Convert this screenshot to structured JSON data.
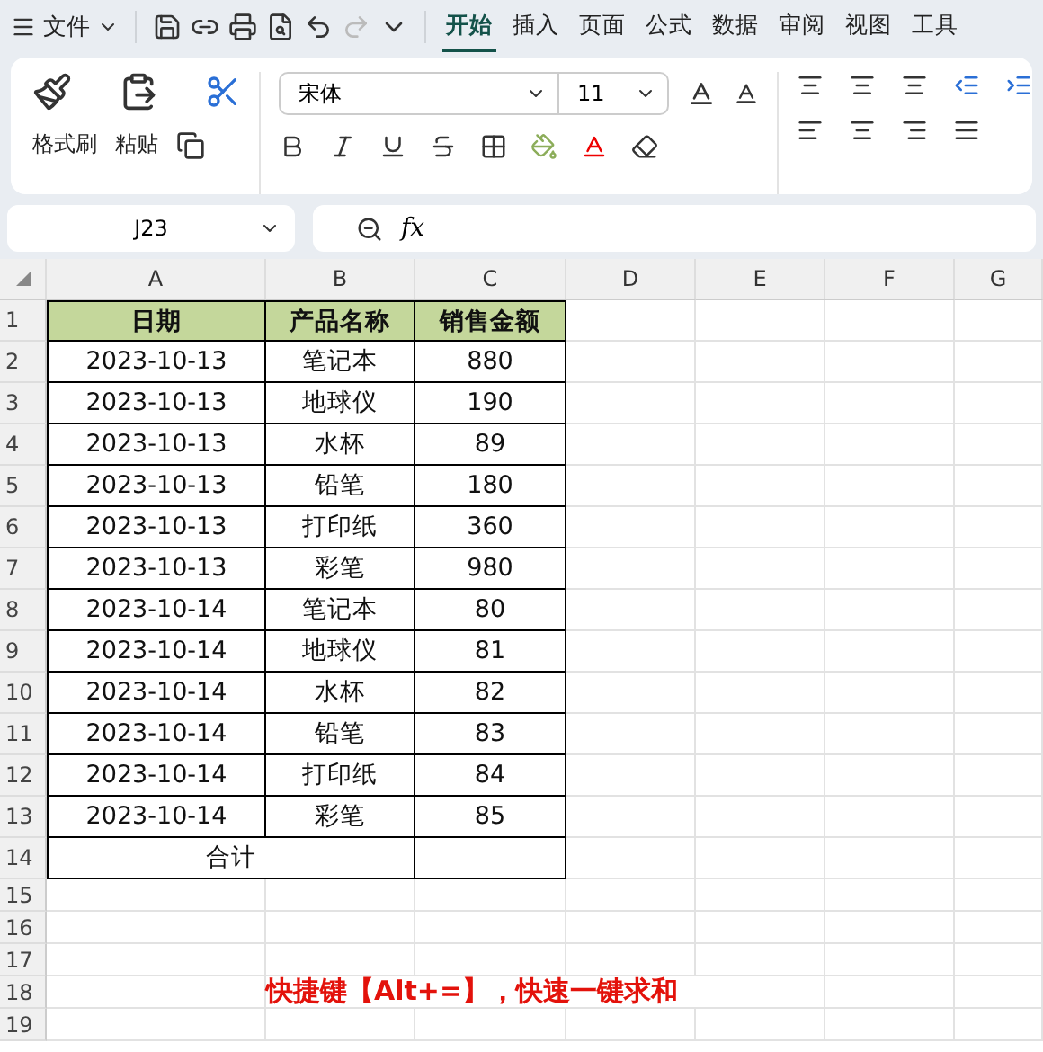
{
  "menu_bar": {
    "file_menu": "文件",
    "tabs": [
      {
        "label": "开始",
        "selected": true
      },
      {
        "label": "插入",
        "selected": false
      },
      {
        "label": "页面",
        "selected": false
      },
      {
        "label": "公式",
        "selected": false
      },
      {
        "label": "数据",
        "selected": false
      },
      {
        "label": "审阅",
        "selected": false
      },
      {
        "label": "视图",
        "selected": false
      },
      {
        "label": "工具",
        "selected": false
      }
    ]
  },
  "ribbon": {
    "format_painter": "格式刷",
    "paste": "粘贴",
    "font_name": "宋体",
    "font_size": "11"
  },
  "formula_bar": {
    "name_box": "J23",
    "fx": "fx"
  },
  "sheet": {
    "columns": [
      "A",
      "B",
      "C",
      "D",
      "E",
      "F",
      "G"
    ],
    "rows": [
      {
        "number": "1",
        "kind": "header",
        "cells": [
          "日期",
          "产品名称",
          "销售金额"
        ]
      },
      {
        "number": "2",
        "kind": "data",
        "cells": [
          "2023-10-13",
          "笔记本",
          "880"
        ]
      },
      {
        "number": "3",
        "kind": "data",
        "cells": [
          "2023-10-13",
          "地球仪",
          "190"
        ]
      },
      {
        "number": "4",
        "kind": "data",
        "cells": [
          "2023-10-13",
          "水杯",
          "89"
        ]
      },
      {
        "number": "5",
        "kind": "data",
        "cells": [
          "2023-10-13",
          "铅笔",
          "180"
        ]
      },
      {
        "number": "6",
        "kind": "data",
        "cells": [
          "2023-10-13",
          "打印纸",
          "360"
        ]
      },
      {
        "number": "7",
        "kind": "data",
        "cells": [
          "2023-10-13",
          "彩笔",
          "980"
        ]
      },
      {
        "number": "8",
        "kind": "data",
        "cells": [
          "2023-10-14",
          "笔记本",
          "80"
        ]
      },
      {
        "number": "9",
        "kind": "data",
        "cells": [
          "2023-10-14",
          "地球仪",
          "81"
        ]
      },
      {
        "number": "10",
        "kind": "data",
        "cells": [
          "2023-10-14",
          "水杯",
          "82"
        ]
      },
      {
        "number": "11",
        "kind": "data",
        "cells": [
          "2023-10-14",
          "铅笔",
          "83"
        ]
      },
      {
        "number": "12",
        "kind": "data",
        "cells": [
          "2023-10-14",
          "打印纸",
          "84"
        ]
      },
      {
        "number": "13",
        "kind": "data",
        "cells": [
          "2023-10-14",
          "彩笔",
          "85"
        ]
      },
      {
        "number": "14",
        "kind": "total",
        "cells": [
          "合计"
        ]
      },
      {
        "number": "15",
        "kind": "empty",
        "cells": []
      },
      {
        "number": "16",
        "kind": "empty",
        "cells": []
      },
      {
        "number": "17",
        "kind": "empty",
        "cells": []
      },
      {
        "number": "18",
        "kind": "note",
        "cells": [
          "",
          "快捷键【Alt+=】，快速一键求和"
        ]
      },
      {
        "number": "19",
        "kind": "empty",
        "cells": []
      }
    ]
  }
}
